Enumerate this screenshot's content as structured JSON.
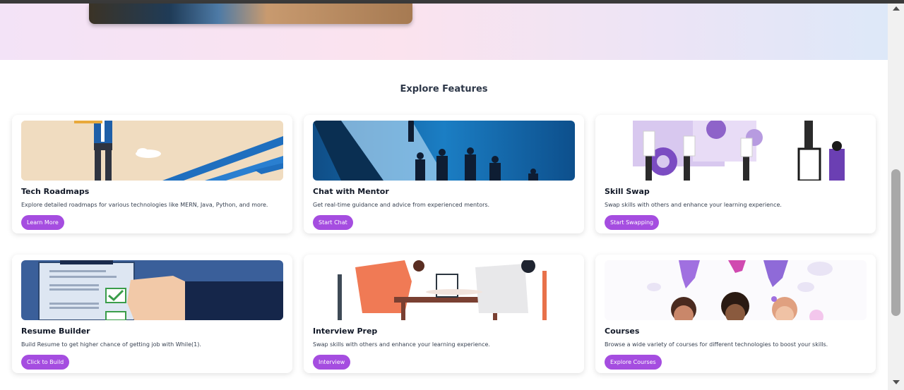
{
  "section": {
    "title": "Explore Features"
  },
  "cards": [
    {
      "title": "Tech Roadmaps",
      "description": "Explore detailed roadmaps for various technologies like MERN, Java, Python, and more.",
      "button": "Learn More"
    },
    {
      "title": "Chat with Mentor",
      "description": "Get real-time guidance and advice from experienced mentors.",
      "button": "Start Chat"
    },
    {
      "title": "Skill Swap",
      "description": "Swap skills with others and enhance your learning experience.",
      "button": "Start Swapping"
    },
    {
      "title": "Resume Builder",
      "description": "Build Resume to get higher chance of getting job with While(1).",
      "button": "Click to Build"
    },
    {
      "title": "Interview Prep",
      "description": "Swap skills with others and enhance your learning experience.",
      "button": "Interview"
    },
    {
      "title": "Courses",
      "description": "Browse a wide variety of courses for different technologies to boost your skills.",
      "button": "Explore Courses"
    }
  ],
  "colors": {
    "accent": "#a54de0",
    "heroGradientStart": "#f3e3f7",
    "heroGradientEnd": "#dde8f8"
  }
}
